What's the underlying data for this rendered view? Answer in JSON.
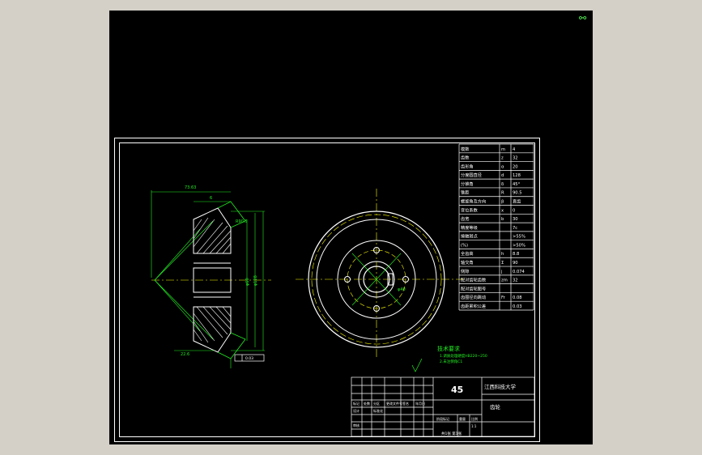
{
  "drawing": {
    "material": "45",
    "school": "江西科技大学",
    "part_name": "齿轮"
  },
  "technical_requirements": {
    "title": "技术要求",
    "line_1": "1.调质处理硬度HB220~250",
    "line_2": "2.未注倒角C1"
  },
  "param_table": [
    {
      "name": "模数",
      "symbol": "m",
      "value": "4"
    },
    {
      "name": "齿数",
      "symbol": "z",
      "value": "32"
    },
    {
      "name": "齿形角",
      "symbol": "α",
      "value": "20"
    },
    {
      "name": "分度圆直径",
      "symbol": "d",
      "value": "128"
    },
    {
      "name": "分锥角",
      "symbol": "δ",
      "value": "45°"
    },
    {
      "name": "锥距",
      "symbol": "R",
      "value": "90.5"
    },
    {
      "name": "螺旋角及方向",
      "symbol": "β",
      "value": "直齿"
    },
    {
      "name": "变位系数",
      "symbol": "x",
      "value": "0"
    },
    {
      "name": "齿宽",
      "symbol": "b",
      "value": "30"
    },
    {
      "name": "精度等级",
      "symbol": "",
      "value": "7c"
    },
    {
      "name": "接触斑点",
      "symbol": "",
      "value": ">55%"
    },
    {
      "name": "(%)",
      "symbol": "",
      "value": ">50%"
    },
    {
      "name": "全齿高",
      "symbol": "h",
      "value": "8.8"
    },
    {
      "name": "轴交角",
      "symbol": "Σ",
      "value": "90"
    },
    {
      "name": "侧隙",
      "symbol": "j",
      "value": "0.074"
    },
    {
      "name": "配对齿轮齿数",
      "symbol": "zm",
      "value": "32"
    },
    {
      "name": "配对齿轮图号",
      "symbol": "",
      "value": ""
    },
    {
      "name": "齿圈径向跳动",
      "symbol": "Fr",
      "value": "0.08"
    },
    {
      "name": "齿距累积公差",
      "symbol": "",
      "value": "0.03"
    }
  ],
  "dimensions": {
    "top_overall": "73.63",
    "top_inner": "6",
    "cone_distance": "R90.5",
    "dia_large": "φ128",
    "dia_bore": "φ40",
    "dia_hub": "φ60",
    "angle": "45°",
    "bottom_len": "22.6",
    "tol_box": "0.03"
  },
  "title_block": {
    "row_labels": [
      "标记",
      "处数",
      "分区",
      "更改文件号",
      "签名",
      "年月日"
    ],
    "designer_label": "设计",
    "reviewer_label": "审核",
    "std_label": "标准化",
    "stage_label": "阶段标记",
    "weight_label": "重量",
    "scale_label": "比例",
    "scale_value": "1:1",
    "sheet_info": "共1张 第1张"
  }
}
